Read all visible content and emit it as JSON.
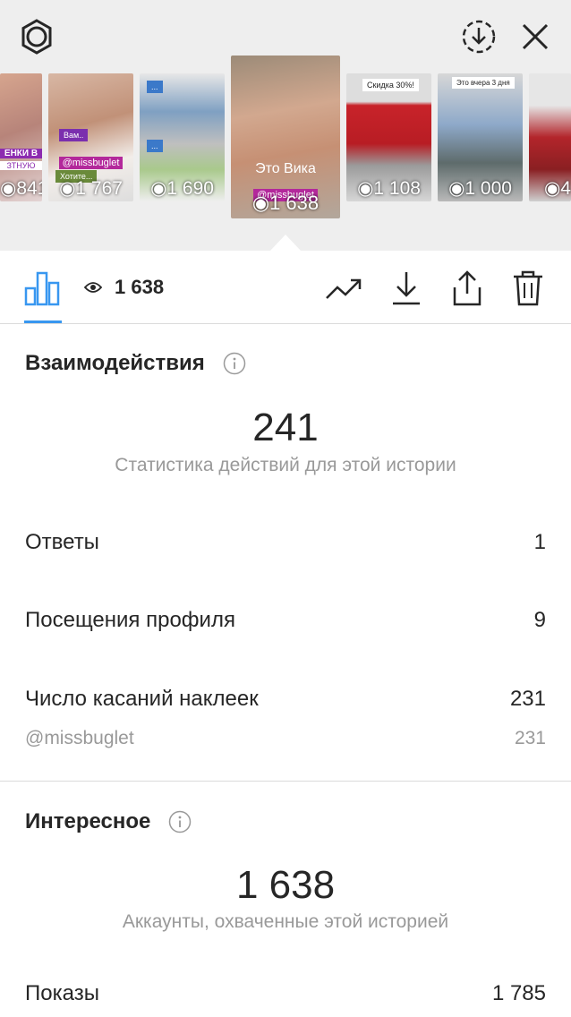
{
  "thumbnails": [
    {
      "views": "841",
      "caption": "ЕНКИ В",
      "caption2": "ЗТНУЮ"
    },
    {
      "views": "1 767",
      "caption": "@missbuglet"
    },
    {
      "views": "1 690",
      "caption": ""
    },
    {
      "views": "1 638",
      "caption": "Это Вика",
      "tag": "@missbuglet",
      "active": true
    },
    {
      "views": "1 108",
      "sticker": "Скидка 30%!"
    },
    {
      "views": "1 000",
      "sticker": "Это вчера 3 дня"
    },
    {
      "views": "4",
      "caption": ""
    }
  ],
  "toolbar": {
    "view_count": "1 638"
  },
  "interactions": {
    "title": "Взаимодействия",
    "total": "241",
    "subtitle": "Статистика действий для этой истории",
    "rows": [
      {
        "label": "Ответы",
        "value": "1"
      },
      {
        "label": "Посещения профиля",
        "value": "9"
      },
      {
        "label": "Число касаний наклеек",
        "value": "231"
      }
    ],
    "sticker_row": {
      "label": "@missbuglet",
      "value": "231"
    }
  },
  "discovery": {
    "title": "Интересное",
    "total": "1 638",
    "subtitle": "Аккаунты, охваченные этой историей",
    "rows": [
      {
        "label": "Показы",
        "value": "1 785"
      }
    ]
  },
  "colors": {
    "accent": "#3897f0",
    "muted": "#999999",
    "text": "#262626",
    "tag": "#b3289b"
  },
  "icons": [
    "settings-icon",
    "download-circle-icon",
    "close-icon",
    "bar-chart-icon",
    "eye-icon",
    "trend-icon",
    "download-icon",
    "share-icon",
    "trash-icon",
    "info-icon"
  ]
}
